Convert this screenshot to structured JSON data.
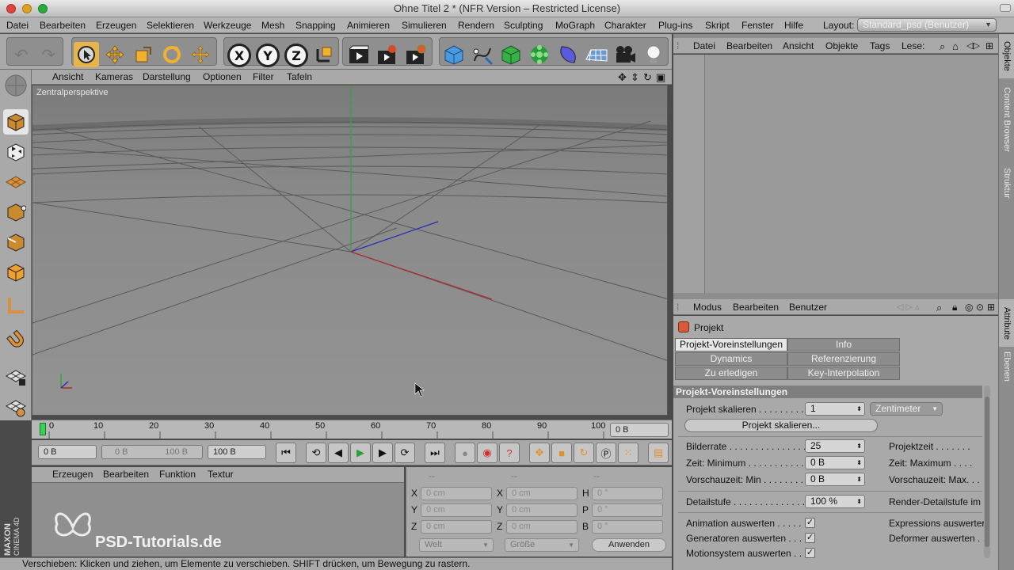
{
  "window": {
    "title": "Ohne Titel 2 * (NFR Version – Restricted License)"
  },
  "menubar": {
    "items": [
      "Datei",
      "Bearbeiten",
      "Erzeugen",
      "Selektieren",
      "Werkzeuge",
      "Mesh",
      "Snapping",
      "Animieren",
      "Simulieren",
      "Rendern",
      "Sculpting",
      "MoGraph",
      "Charakter",
      "Plug-ins",
      "Skript",
      "Fenster",
      "Hilfe"
    ],
    "layout_label": "Layout:",
    "layout_value": "Standard_psd (Benutzer)"
  },
  "toolbar": {
    "axis_x": "X",
    "axis_y": "Y",
    "axis_z": "Z",
    "icons": [
      "undo-icon",
      "redo-icon",
      "select-icon",
      "move-icon",
      "scale-icon",
      "rotate-icon",
      "transform-icon",
      "coordinate-system-icon",
      "render-view-icon",
      "render-picture-queue-icon",
      "render-settings-icon",
      "cube-icon",
      "spline-pen-icon",
      "nurbs-icon",
      "array-icon",
      "deformer-icon",
      "floor-icon",
      "camera-icon",
      "light-icon"
    ]
  },
  "viewport": {
    "menu": [
      "Ansicht",
      "Kameras",
      "Darstellung",
      "Optionen",
      "Filter",
      "Tafeln"
    ],
    "label": "Zentralperspektive"
  },
  "timeline": {
    "ticks": [
      "0",
      "10",
      "20",
      "30",
      "40",
      "50",
      "60",
      "70",
      "80",
      "90",
      "100"
    ],
    "frame_field": "0 B"
  },
  "transport": {
    "start": "0 B",
    "range_min": "0 B",
    "range_max": "100 B",
    "end": "100 B"
  },
  "material": {
    "menu": [
      "Erzeugen",
      "Bearbeiten",
      "Funktion",
      "Textur"
    ]
  },
  "coordinates": {
    "header_dashes": [
      "--",
      "--",
      "--"
    ],
    "rows": [
      {
        "a": "X",
        "av": "0 cm",
        "b": "X",
        "bv": "0 cm",
        "c": "H",
        "cv": "0 °"
      },
      {
        "a": "Y",
        "av": "0 cm",
        "b": "Y",
        "bv": "0 cm",
        "c": "P",
        "cv": "0 °"
      },
      {
        "a": "Z",
        "av": "0 cm",
        "b": "Z",
        "bv": "0 cm",
        "c": "B",
        "cv": "0 °"
      }
    ],
    "mode1": "Welt",
    "mode2": "Größe",
    "apply": "Anwenden"
  },
  "watermark": {
    "brand": "PSD-Tutorials.de",
    "maxon": "MAXON",
    "c4d": "CINEMA 4D"
  },
  "statusbar": "Verschieben: Klicken und ziehen, um Elemente zu verschieben. SHIFT drücken, um Bewegung zu rastern.",
  "objects": {
    "menu": [
      "Datei",
      "Bearbeiten",
      "Ansicht",
      "Objekte",
      "Tags",
      "Lese:"
    ]
  },
  "attributes": {
    "menu": [
      "Modus",
      "Bearbeiten",
      "Benutzer"
    ],
    "object_name": "Projekt",
    "tabs": [
      [
        "Projekt-Voreinstellungen",
        "Info"
      ],
      [
        "Dynamics",
        "Referenzierung"
      ],
      [
        "Zu erledigen",
        "Key-Interpolation"
      ]
    ],
    "section_title": "Projekt-Voreinstellungen",
    "scale_label": "Projekt skalieren . . . . . . . . .",
    "scale_value": "1",
    "scale_unit": "Zentimeter",
    "scale_button": "Projekt skalieren...",
    "fps_label": "Bilderrate . . . . . . . . . . . . . . . .",
    "fps_value": "25",
    "project_time": "Projektzeit . . . . . . .",
    "min_time_label": "Zeit: Minimum . . . . . . . . . . . .",
    "min_time_value": "0 B",
    "max_time_label": "Zeit: Maximum . . . .",
    "prev_min_label": "Vorschauzeit: Min . . . . . . . .",
    "prev_min_value": "0 B",
    "prev_max_label": "Vorschauzeit: Max. . .",
    "detail_label": "Detailstufe . . . . . . . . . . . . . .",
    "detail_value": "100 %",
    "render_detail_label": "Render-Detailstufe im",
    "anim_label": "Animation auswerten . . . . .",
    "expr_label": "Expressions auswerter",
    "gen_label": "Generatoren auswerten . . .",
    "deform_label": "Deformer auswerten . . .",
    "motion_label": "Motionsystem auswerten . . .",
    "check": "✓"
  },
  "side_tabs": [
    "Objekte",
    "Content Browser",
    "Struktur",
    "Attribute",
    "Ebenen"
  ]
}
